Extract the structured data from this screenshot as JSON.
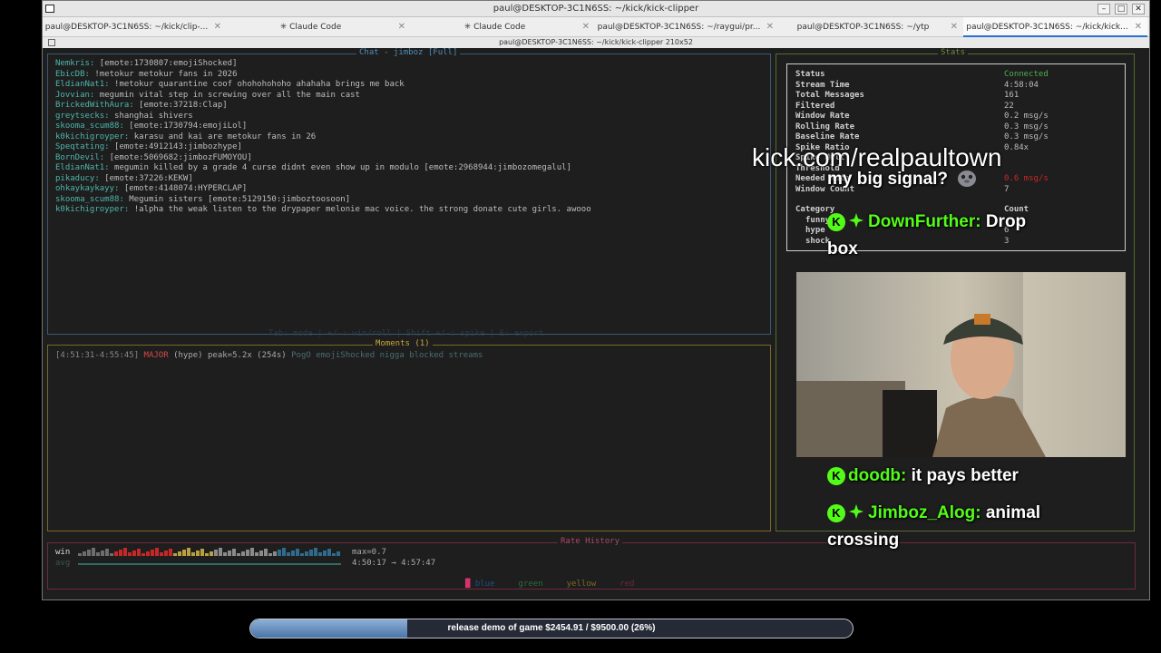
{
  "window": {
    "title": "paul@DESKTOP-3C1N6SS: ~/kick/kick-clipper",
    "subtitle": "paul@DESKTOP-3C1N6SS: ~/kick/kick-clipper 210x52",
    "tabs": [
      {
        "label": "paul@DESKTOP-3C1N6SS: ~/kick/clip-...",
        "active": false
      },
      {
        "label": "✳ Claude Code",
        "active": false
      },
      {
        "label": "✳ Claude Code",
        "active": false
      },
      {
        "label": "paul@DESKTOP-3C1N6SS: ~/raygui/pr...",
        "active": false
      },
      {
        "label": "paul@DESKTOP-3C1N6SS: ~/ytp",
        "active": false
      },
      {
        "label": "paul@DESKTOP-3C1N6SS: ~/kick/kick...",
        "active": true
      }
    ]
  },
  "chat": {
    "title": "Chat - jimboz [Full]",
    "lines": [
      {
        "user": "Nemkris:",
        "text": " [emote:1730807:emojiShocked]"
      },
      {
        "user": "EbicDB:",
        "text": " !metokur metokur fans in 2026"
      },
      {
        "user": "EldianNat1:",
        "text": " !metokur quarantine coof ohohohohoho ahahaha brings me back"
      },
      {
        "user": "Jovvian:",
        "text": " megumin vital step in screwing over all the main cast"
      },
      {
        "user": "BrickedWithAura:",
        "text": " [emote:37218:Clap]"
      },
      {
        "user": "greytsecks:",
        "text": " shanghai shivers"
      },
      {
        "user": "skooma_scum88:",
        "text": " [emote:1730794:emojiLol]"
      },
      {
        "user": "k0kichigroyper:",
        "text": " karasu and kai are metokur fans in 26"
      },
      {
        "user": "Speqtating:",
        "text": " [emote:4912143:jimbozhype]"
      },
      {
        "user": "BornDevil:",
        "text": " [emote:5069682:jimbozFUMOYOU]"
      },
      {
        "user": "EldianNat1:",
        "text": " megumin killed by a grade 4 curse didnt even show up in modulo [emote:2968944:jimbozomegalul]"
      },
      {
        "user": "pikaducy:",
        "text": " [emote:37226:KEKW]"
      },
      {
        "user": "ohkaykaykayy:",
        "text": " [emote:4148074:HYPERCLAP]"
      },
      {
        "user": "skooma_scum88:",
        "text": " Megumin sisters [emote:5129150:jimboztoosoon]"
      },
      {
        "user": "k0kichigroyper:",
        "text": " !alpha the weak listen to the drypaper melonie mac voice. the strong donate cute girls. awooo"
      }
    ]
  },
  "hint": "Tab: mode | +/-: win/roll | Shift +/-: spike | E: export",
  "moments": {
    "title": "Moments (1)",
    "row": {
      "time": "[4:51:31-4:55:45]",
      "severity": "MAJOR",
      "detail": "(hype) peak=5.2x (254s)",
      "chat": "PogO emojiShocked nigga blocked streams"
    }
  },
  "stats": {
    "title": "Stats",
    "rows": [
      {
        "label": "Status",
        "value": "Connected",
        "tone": "green"
      },
      {
        "label": "Stream Time",
        "value": "4:58:04",
        "tone": ""
      },
      {
        "label": "Total Messages",
        "value": "161",
        "tone": ""
      },
      {
        "label": "Filtered",
        "value": "22",
        "tone": ""
      },
      {
        "label": "Window Rate",
        "value": "0.2 msg/s",
        "tone": ""
      },
      {
        "label": "Rolling Rate",
        "value": "0.3 msg/s",
        "tone": ""
      },
      {
        "label": "Baseline Rate",
        "value": "0.3 msg/s",
        "tone": ""
      },
      {
        "label": "Spike Ratio",
        "value": "0.84x",
        "tone": ""
      },
      {
        "label": "Spike Mult",
        "value": "",
        "tone": ""
      },
      {
        "label": "Threshold",
        "value": "",
        "tone": ""
      },
      {
        "label": "Needed Rate",
        "value": "0.6 msg/s",
        "tone": "red"
      },
      {
        "label": "Window Count",
        "value": "7",
        "tone": ""
      }
    ],
    "category_header": "Category",
    "count_header": "Count",
    "categories": [
      {
        "name": "funny",
        "count": ""
      },
      {
        "name": "hype",
        "count": "6"
      },
      {
        "name": "shock",
        "count": "3"
      }
    ]
  },
  "rate_history": {
    "title": "Rate History",
    "win_label": "win",
    "avg_label": "avg",
    "max": "max=0.7",
    "range": "4:50:17 → 4:57:47",
    "legend": [
      {
        "label": "blue",
        "color": "#1f4e8c"
      },
      {
        "label": "green",
        "color": "#2e6b3a"
      },
      {
        "label": "yellow",
        "color": "#7a6a24"
      },
      {
        "label": "red",
        "color": "#6e2940"
      }
    ],
    "legend_marker_color": "#d6336c"
  },
  "overlay": {
    "domain": "kick.com/realpaultown",
    "messages": [
      {
        "user": "",
        "text": "my big signal?",
        "badges": []
      },
      {
        "user": "DownFurther:",
        "text": "Drop",
        "cont": "box",
        "badges": [
          "kick-badge-icon",
          "gem-badge-icon"
        ]
      },
      {
        "user": "doodb:",
        "text": "it pays better",
        "badges": [
          "kick-badge-icon"
        ]
      },
      {
        "user": "Jimboz_Alog:",
        "text": "animal",
        "cont": "crossing",
        "badges": [
          "kick-badge-icon",
          "gem-badge-icon"
        ]
      }
    ],
    "goal": {
      "text": "release demo of game $2454.91 / $9500.00 (26%)",
      "fraction": 0.26
    },
    "accent": "#53fc18"
  }
}
